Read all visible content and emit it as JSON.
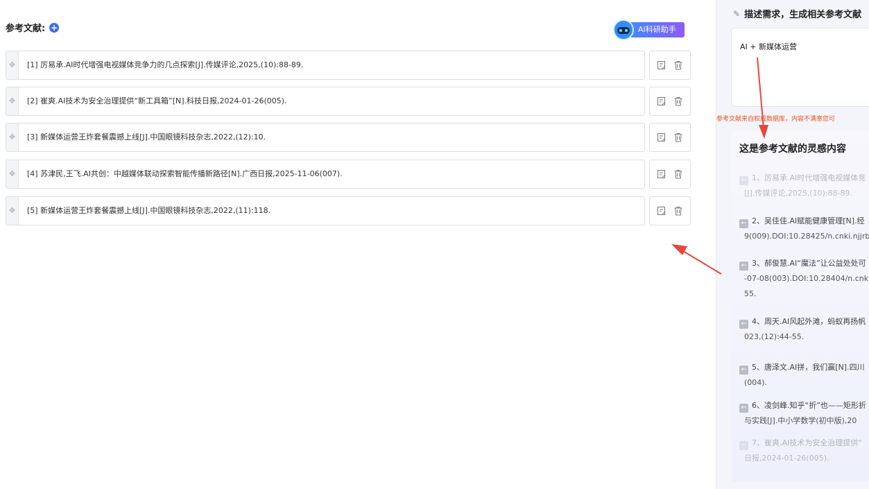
{
  "left": {
    "title": "参考文献:",
    "add_icon": "plus-icon",
    "ai_assistant_label": "AI科研助手",
    "references": [
      "[1] 厉易承.AI时代增强电视媒体竞争力的几点探索[J].传媒评论,2025,(10):88-89.",
      "[2] 崔爽.AI技术为安全治理提供“新工具箱”[N].科技日报,2024-01-26(005).",
      "[3] 新媒体运营王炸套餐震撼上线[J].中国眼镜科技杂志,2022,(12):10.",
      "[4] 苏津民,王飞.AI共创：中越媒体联动探索智能传播新路径[N].广西日报,2025-11-06(007).",
      "[5] 新媒体运营王炸套餐震撼上线[J].中国眼镜科技杂志,2022,(11):118."
    ]
  },
  "right": {
    "request_title": "描述需求，生成相关参考文献",
    "request_text": "AI + 新媒体运营",
    "notice": "参考文献来自权威数据库，内容不满意您可",
    "inspiration_title": "这是参考文献的灵感内容",
    "items": [
      {
        "line1": "1、厉易承.AI时代增强电视媒体竞",
        "line2": "[J].传媒评论,2025,(10):88-89."
      },
      {
        "line1": "2、吴佳佳.AI赋能健康管理[N].经",
        "line2": "9(009).DOI:10.28425/n.cnki.njjrb"
      },
      {
        "line1": "3、郝俊慧.AI“魔法”让公益处处可",
        "line2": "-07-08(003).DOI:10.28404/n.cnki",
        "line3": "55."
      },
      {
        "line1": "4、周天.AI风起外滩，蚂蚁再扬帆",
        "line2": "023,(12):44-55."
      },
      {
        "line1": "5、唐泽文.AI拼，我们赢[N].四川",
        "line2": "(004)."
      },
      {
        "line1": "6、凌剑峰.知乎“折”也——矩形折",
        "line2": "与实践[J].中小学数学(初中版),20"
      },
      {
        "line1": "7、崔爽.AI技术为安全治理提供“",
        "line2": "日报,2024-01-26(005)."
      }
    ]
  },
  "colors": {
    "accent": "#3f6df0",
    "arrow": "#e8473c",
    "notice": "#e8541e"
  }
}
